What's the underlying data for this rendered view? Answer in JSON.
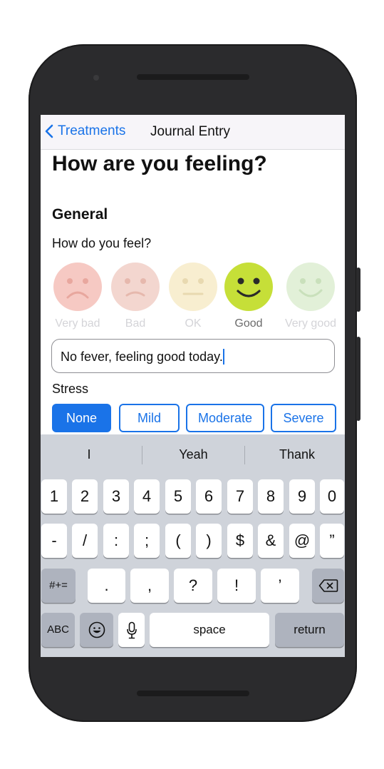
{
  "nav": {
    "back_label": "Treatments",
    "title": "Journal Entry"
  },
  "page": {
    "heading": "How are you feeling?",
    "section_title": "General",
    "question": "How do you feel?"
  },
  "moods": [
    {
      "label": "Very bad",
      "selected": false,
      "color": "#f6c9c3"
    },
    {
      "label": "Bad",
      "selected": false,
      "color": "#f3d6cf"
    },
    {
      "label": "OK",
      "selected": false,
      "color": "#f8eed0"
    },
    {
      "label": "Good",
      "selected": true,
      "color": "#c6df38"
    },
    {
      "label": "Very good",
      "selected": false,
      "color": "#e2f0d8"
    }
  ],
  "note": {
    "value": "No fever, feeling good today."
  },
  "stress": {
    "label": "Stress",
    "options": [
      "None",
      "Mild",
      "Moderate",
      "Severe"
    ],
    "selected": "None"
  },
  "keyboard": {
    "suggestions": [
      "I",
      "Yeah",
      "Thank"
    ],
    "row1": [
      "1",
      "2",
      "3",
      "4",
      "5",
      "6",
      "7",
      "8",
      "9",
      "0"
    ],
    "row2": [
      "-",
      "/",
      ":",
      ";",
      "(",
      ")",
      "$",
      "&",
      "@",
      "”"
    ],
    "row3": [
      "#+=",
      ".",
      ",",
      "?",
      "!",
      "’"
    ],
    "abc_label": "ABC",
    "space_label": "space",
    "return_label": "return"
  },
  "colors": {
    "accent": "#1a73e8",
    "frame": "#2b2b2d",
    "keyboard_bg": "#cfd3da"
  }
}
